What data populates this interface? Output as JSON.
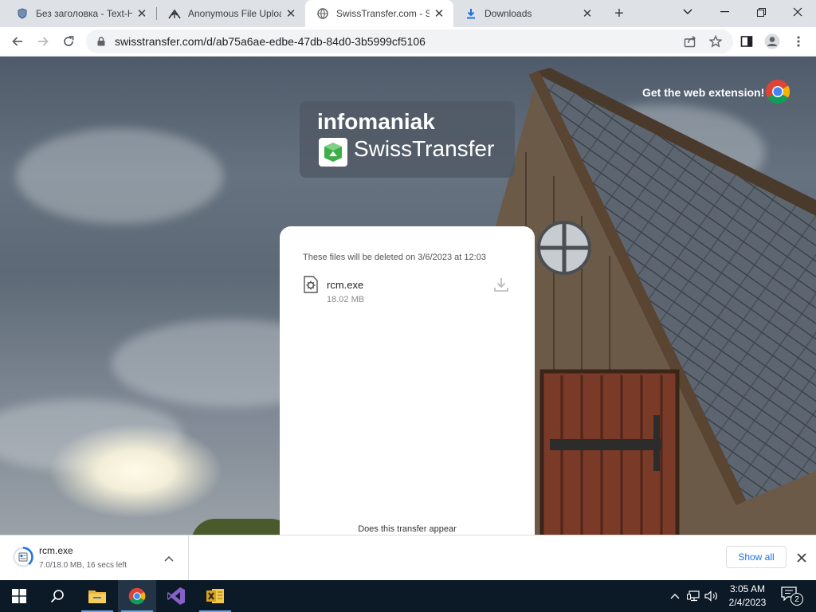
{
  "browser": {
    "tabs": [
      {
        "title": "Без заголовка - Text-Hosting",
        "favicon": "shield-icon"
      },
      {
        "title": "Anonymous File Upload",
        "favicon": "upload-icon"
      },
      {
        "title": "SwissTransfer.com - Send large files",
        "favicon": "globe-icon"
      },
      {
        "title": "Downloads",
        "favicon": "download-icon"
      }
    ],
    "active_tab_index": 2,
    "url": "swisstransfer.com/d/ab75a6ae-edbe-47db-84d0-3b5999cf5106"
  },
  "page": {
    "brand": "infomaniak",
    "product": "SwissTransfer",
    "extension_cta": "Get the web extension!",
    "card": {
      "deletion_note": "These files will be deleted on 3/6/2023 at 12:03",
      "file": {
        "name": "rcm.exe",
        "size": "18.02 MB"
      },
      "question": "Does this transfer appear"
    }
  },
  "download_shelf": {
    "item": {
      "name": "rcm.exe",
      "status": "7.0/18.0 MB, 16 secs left",
      "progress_fraction": 0.39
    },
    "show_all_label": "Show all"
  },
  "taskbar": {
    "apps": [
      "start-icon",
      "search-icon",
      "file-explorer-icon",
      "chrome-icon",
      "visual-studio-icon",
      "excel-icon"
    ],
    "time": "3:05 AM",
    "date": "2/4/2023",
    "notification_count": "2"
  },
  "colors": {
    "accent": "#1a73e8",
    "swisstransfer_green": "#3fae49",
    "taskbar": "#0c1a28"
  }
}
